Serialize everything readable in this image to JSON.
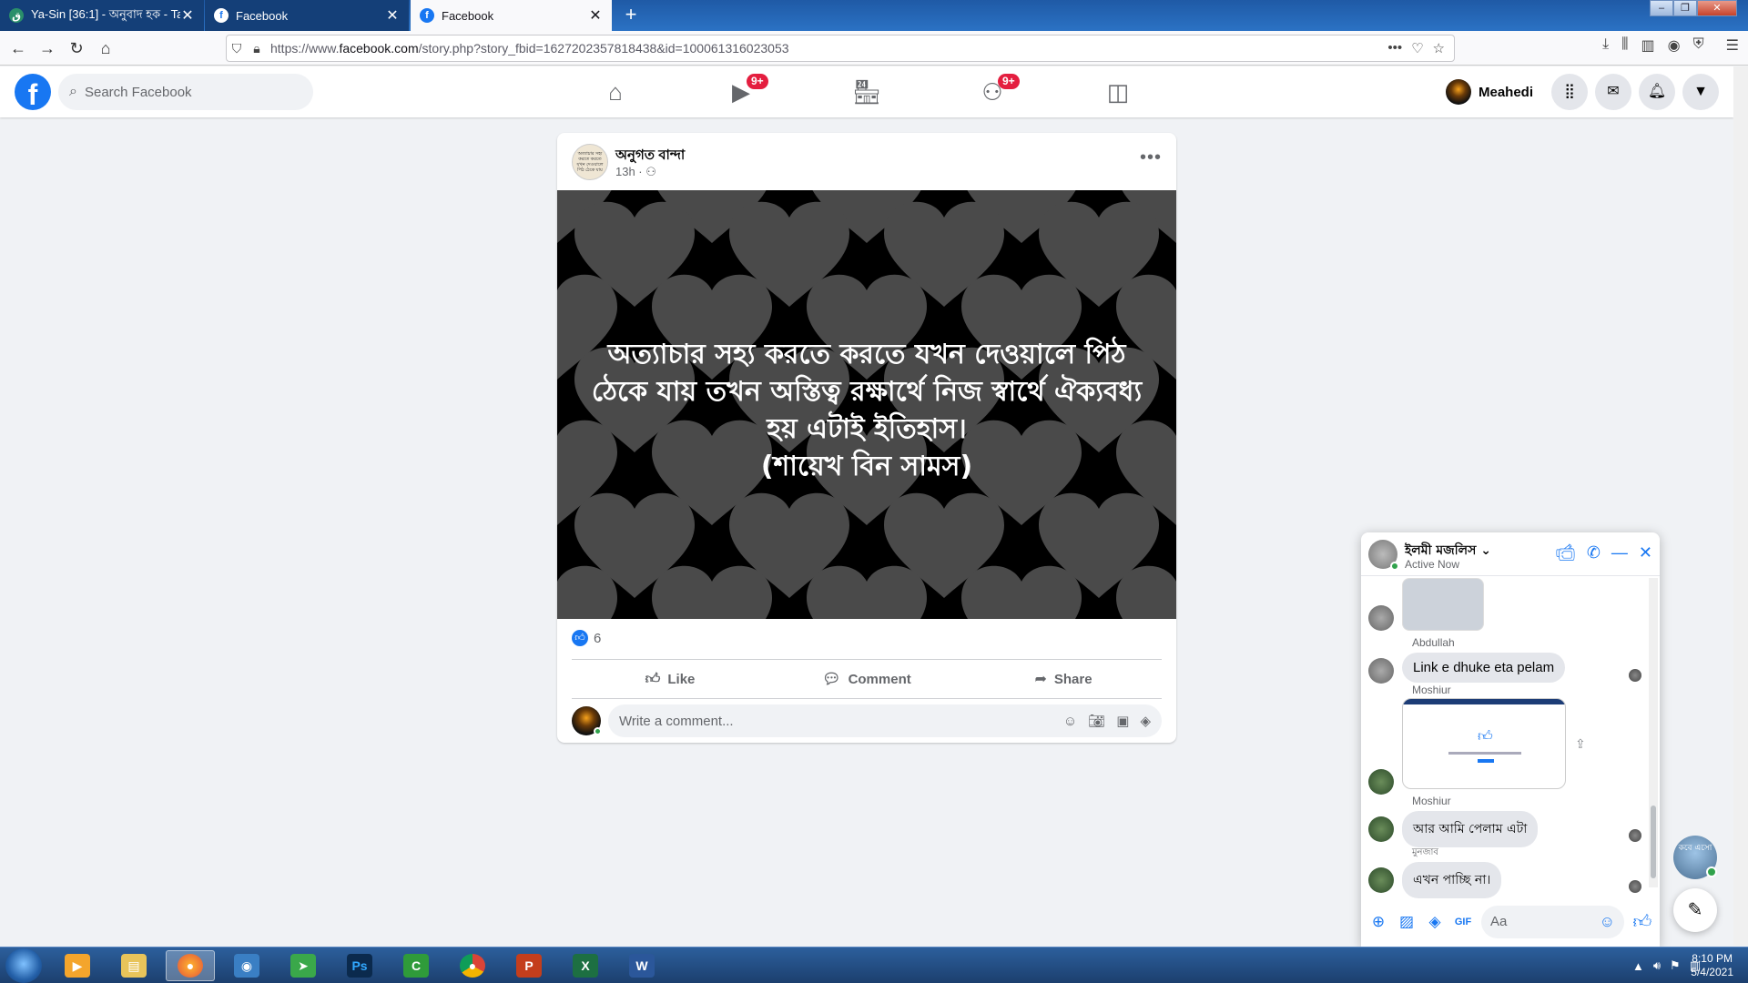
{
  "browser": {
    "tabs": [
      {
        "title": "Ya-Sin [36:1] - অনুবাদ হক - Tanz",
        "active": false
      },
      {
        "title": "Facebook",
        "active": false
      },
      {
        "title": "Facebook",
        "active": true
      }
    ],
    "url_prefix": "https://www.",
    "url_domain": "facebook.com",
    "url_path": "/story.php?story_fbid=1627202357818438&id=100061316023053"
  },
  "facebook": {
    "logo": "f",
    "search_placeholder": "Search Facebook",
    "nav_badges": {
      "watch": "9+",
      "groups": "9+"
    },
    "profile_name": "Meahedi"
  },
  "post": {
    "author": "অনুগত বান্দা",
    "meta": "13h · ",
    "avatar_text": "অত্যাচার সহ্য করতে করতে যখন দেওয়ালে পিঠ ঠেকে যায়",
    "image_text_lines": [
      "অত্যাচার সহ্য করতে করতে যখন দেওয়ালে পিঠ",
      "ঠেকে যায় তখন অস্তিত্ব রক্ষার্থে নিজ স্বার্থে ঐক্যবধ্য",
      "হয় এটাই ইতিহাস।",
      "(শায়েখ বিন সামস)"
    ],
    "like_count": "6",
    "actions": {
      "like": "Like",
      "comment": "Comment",
      "share": "Share"
    },
    "comment_placeholder": "Write a comment..."
  },
  "chat": {
    "name": "ইলমী মজলিস",
    "status": "Active Now",
    "messages": [
      {
        "sender": "Abdullah",
        "text": "Link e dhuke eta pelam"
      },
      {
        "sender": "Moshiur",
        "text": ""
      },
      {
        "sender": "Moshiur",
        "text": "আর আমি পেলাম এটা"
      },
      {
        "sender": "মুনজাব",
        "text": "এখন পাচ্ছি না।"
      }
    ],
    "input_placeholder": "Aa"
  },
  "floating_avatar_text": "কবে এসো",
  "taskbar": {
    "time": "8:10 PM",
    "date": "5/4/2021"
  }
}
